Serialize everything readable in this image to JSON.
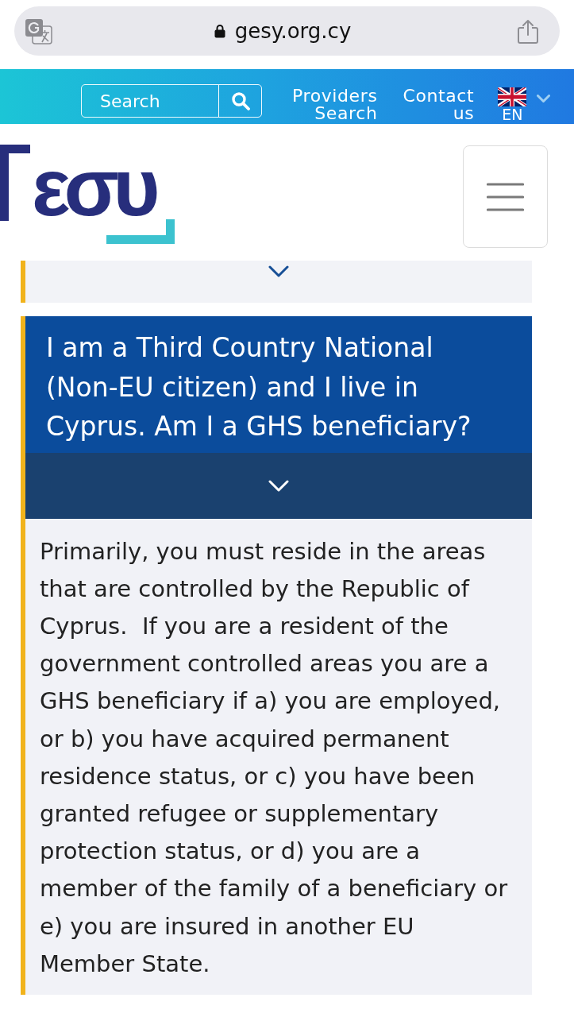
{
  "browser_bar": {
    "url": "gesy.org.cy"
  },
  "nav": {
    "search": {
      "placeholder": "Search"
    },
    "links": [
      "Providers Search",
      "Contact us"
    ],
    "language": "EN"
  },
  "header": {
    "logo_text": "εσυ"
  },
  "faq_items": [
    {
      "expanded": false
    },
    {
      "expanded": true,
      "question": "I am a Third Country National (Non-EU citizen) and I live in Cyprus. Am I a GHS beneficiary?",
      "answer": "Primarily, you must reside in the areas that are controlled by the Republic of Cyprus.  If you are a resident of the government controlled areas you are a GHS beneficiary if a) you are employed, or b) you have acquired permanent residence status, or c) you have been granted refugee or supplementary protection status, or d) you are a member of the family of a beneficiary or e) you are insured in another EU Member State."
    }
  ]
}
